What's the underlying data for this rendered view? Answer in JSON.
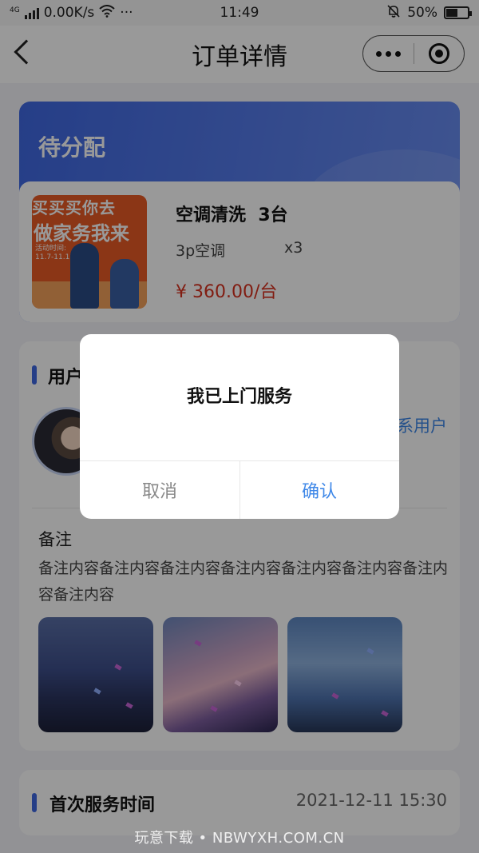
{
  "status_bar": {
    "network": "4G",
    "speed": "0.00K/s",
    "more": "···",
    "time": "11:49",
    "battery": "50%"
  },
  "nav": {
    "title": "订单详情"
  },
  "order": {
    "status": "待分配",
    "product": {
      "thumb_line1": "买买买你去",
      "thumb_line2": "做家务我来",
      "thumb_line3": "活动时间:\n11.7-11.11",
      "name": "空调清洗  3台",
      "spec": "3p空调",
      "qty": "x3",
      "price": "¥ 360.00/台"
    }
  },
  "user_section": {
    "title": "用户",
    "contact": "系用户"
  },
  "notes": {
    "label": "备注",
    "text": "备注内容备注内容备注内容备注内容备注内容备注内容备注内容备注内容"
  },
  "service_time": {
    "title": "首次服务时间",
    "value": "2021-12-11 15:30"
  },
  "modal": {
    "title": "我已上门服务",
    "cancel": "取消",
    "confirm": "确认"
  },
  "watermark": "玩意下载 • NBWYXH.COM.CN",
  "colors": {
    "accent": "#3f68e2",
    "link": "#3f88e8",
    "price": "#d8311f"
  }
}
